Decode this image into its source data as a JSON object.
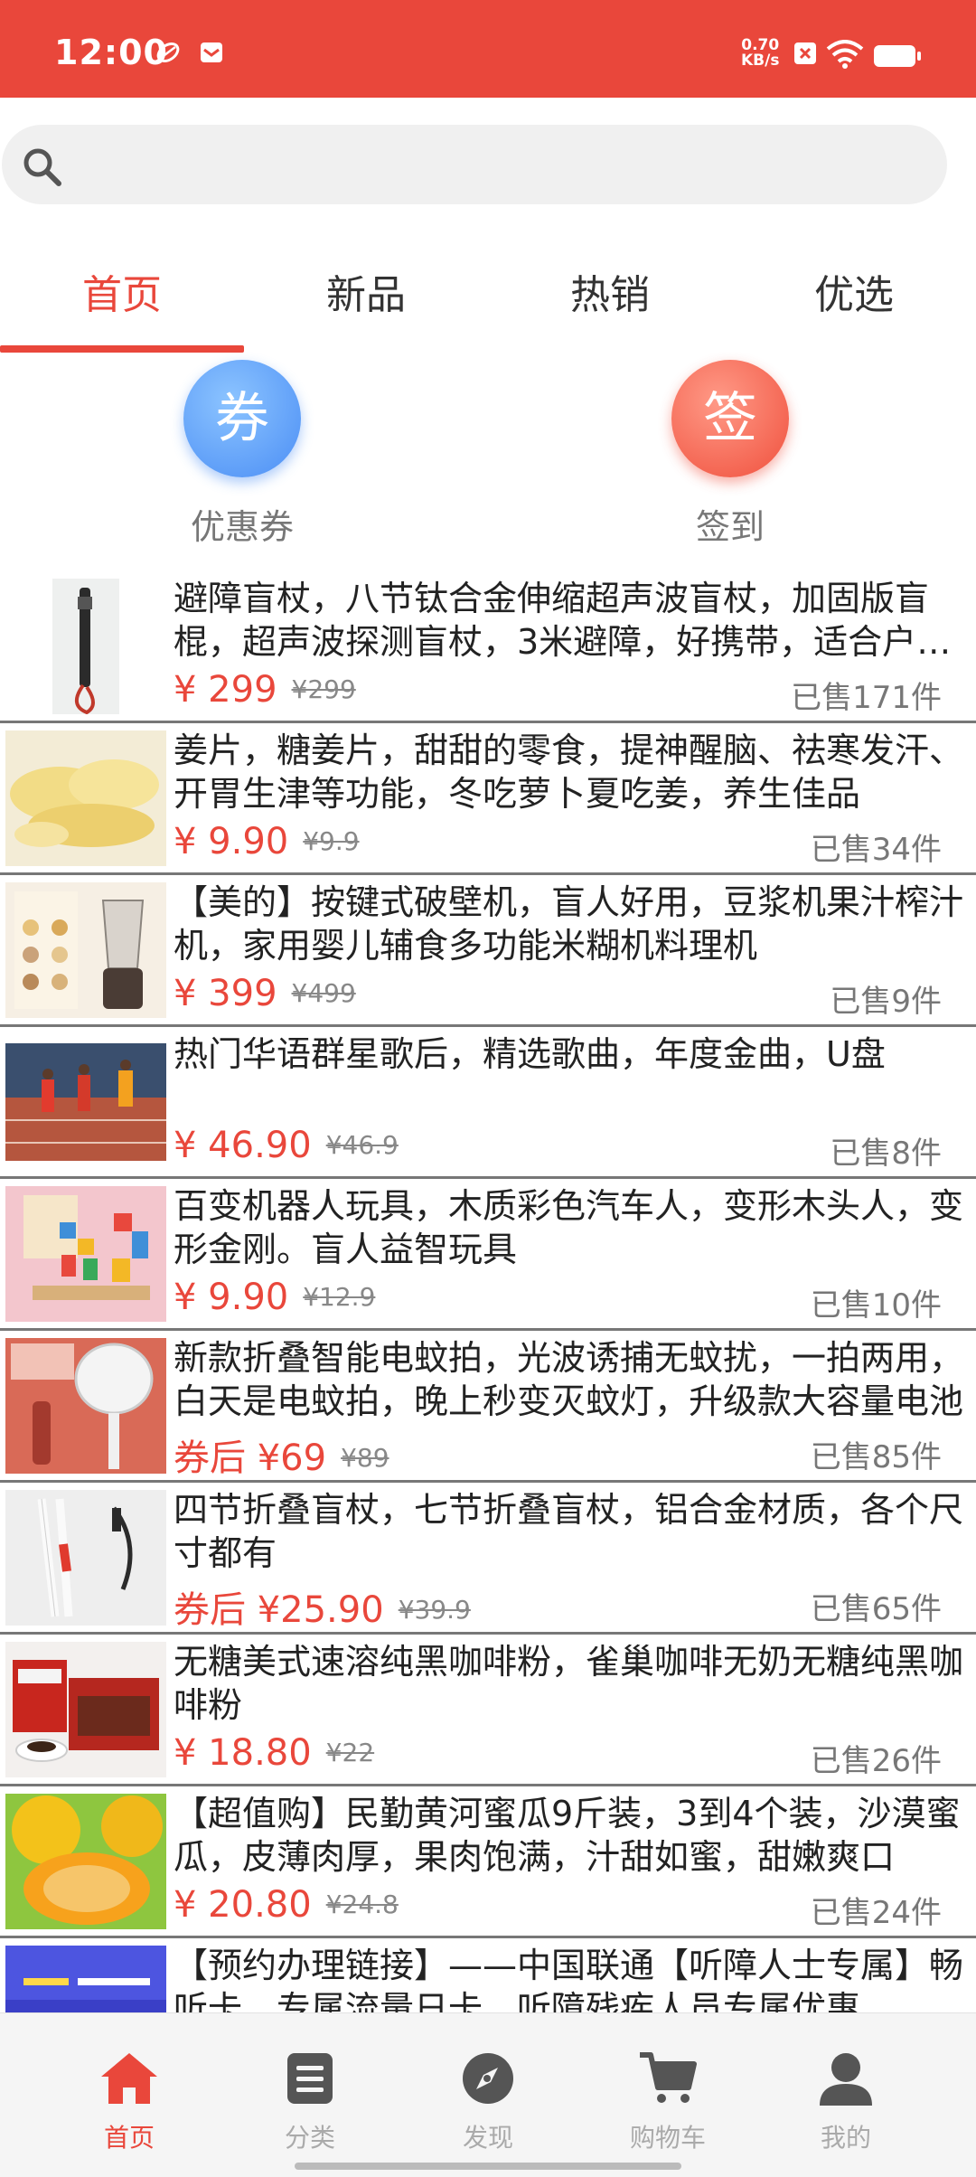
{
  "status_bar": {
    "time": "12:00",
    "net_speed_value": "0.70",
    "net_speed_unit": "KB/s"
  },
  "search": {
    "placeholder": "",
    "value": ""
  },
  "tabs": [
    {
      "label": "首页",
      "active": true
    },
    {
      "label": "新品",
      "active": false
    },
    {
      "label": "热销",
      "active": false
    },
    {
      "label": "优选",
      "active": false
    }
  ],
  "quick_actions": [
    {
      "glyph": "券",
      "label": "优惠券"
    },
    {
      "glyph": "签",
      "label": "签到"
    }
  ],
  "products": [
    {
      "title": "避障盲杖，八节钛合金伸缩超声波盲杖，加固版盲棍，超声波探测盲杖，3米避障，好携带，适合户外出行使用",
      "price": "¥ 299",
      "old_price": "¥299",
      "sold": "已售171件"
    },
    {
      "title": "姜片，糖姜片，甜甜的零食，提神醒脑、祛寒发汗、开胃生津等功能，冬吃萝卜夏吃姜，养生佳品",
      "price": "¥ 9.90",
      "old_price": "¥9.9",
      "sold": "已售34件"
    },
    {
      "title": "【美的】按键式破壁机，盲人好用，豆浆机果汁榨汁机，家用婴儿辅食多功能米糊机料理机",
      "price": "¥ 399",
      "old_price": "¥499",
      "sold": "已售9件"
    },
    {
      "title": "热门华语群星歌后，精选歌曲，年度金曲，U盘",
      "price": "¥ 46.90",
      "old_price": "¥46.9",
      "sold": "已售8件"
    },
    {
      "title": "百变机器人玩具，木质彩色汽车人，变形木头人，变形金刚。盲人益智玩具",
      "price": "¥ 9.90",
      "old_price": "¥12.9",
      "sold": "已售10件"
    },
    {
      "title": "新款折叠智能电蚊拍，光波诱捕无蚊扰，一拍两用，白天是电蚊拍，晚上秒变灭蚊灯，升级款大容量电池",
      "price": "券后 ¥69",
      "old_price": "¥89",
      "sold": "已售85件"
    },
    {
      "title": "四节折叠盲杖，七节折叠盲杖，铝合金材质，各个尺寸都有",
      "price": "券后 ¥25.90",
      "old_price": "¥39.9",
      "sold": "已售65件"
    },
    {
      "title": "无糖美式速溶纯黑咖啡粉，雀巢咖啡无奶无糖纯黑咖啡粉",
      "price": "¥ 18.80",
      "old_price": "¥22",
      "sold": "已售26件"
    },
    {
      "title": "【超值购】民勤黄河蜜瓜9斤装，3到4个装，沙漠蜜瓜，皮薄肉厚，果肉饱满，汁甜如蜜，甜嫩爽口",
      "price": "¥ 20.80",
      "old_price": "¥24.8",
      "sold": "已售24件"
    },
    {
      "title": "【预约办理链接】——中国联通【听障人士专属】畅听卡，专属流量日卡，听障残疾人员专属优惠",
      "price": "",
      "old_price": "",
      "sold": ""
    }
  ],
  "bottom_nav": [
    {
      "label": "首页",
      "icon": "home-icon",
      "active": true
    },
    {
      "label": "分类",
      "icon": "category-icon",
      "active": false
    },
    {
      "label": "发现",
      "icon": "discover-icon",
      "active": false
    },
    {
      "label": "购物车",
      "icon": "cart-icon",
      "active": false
    },
    {
      "label": "我的",
      "icon": "profile-icon",
      "active": false
    }
  ],
  "colors": {
    "brand": "#e9473b",
    "coupon_blue": "#4b8ef5",
    "signin_red": "#f0503d"
  }
}
